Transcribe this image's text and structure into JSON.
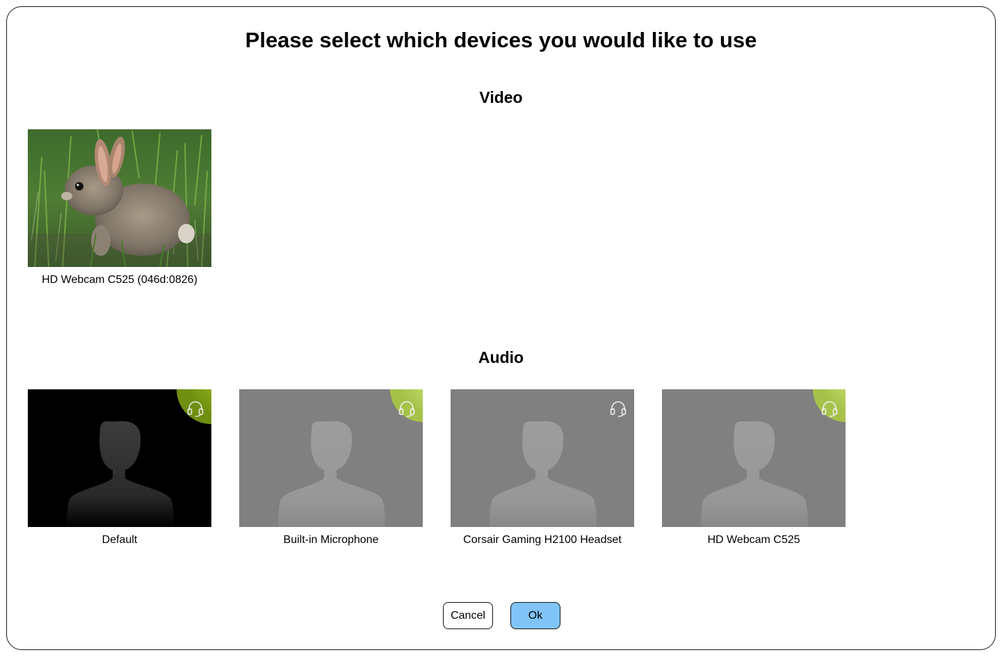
{
  "dialog": {
    "title": "Please select which devices you would like to use",
    "video": {
      "heading": "Video",
      "devices": [
        {
          "label": "HD Webcam C525 (046d:0826)",
          "preview": "rabbit-camera-feed"
        }
      ]
    },
    "audio": {
      "heading": "Audio",
      "devices": [
        {
          "label": "Default",
          "state": "selected",
          "icon": "headset-icon",
          "level": "high"
        },
        {
          "label": "Built-in Microphone",
          "state": "unselected",
          "icon": "headset-icon",
          "level": "medium"
        },
        {
          "label": "Corsair Gaming H2100 Headset",
          "state": "unselected",
          "icon": "headset-icon",
          "level": "none"
        },
        {
          "label": "HD Webcam C525",
          "state": "unselected",
          "icon": "headset-icon",
          "level": "medium"
        }
      ]
    },
    "buttons": {
      "cancel": "Cancel",
      "ok": "Ok"
    }
  },
  "colors": {
    "ok_button": "#80c4f7",
    "selected_tile": "#000000",
    "unselected_tile": "#808080",
    "level_indicator": "#b5d334"
  }
}
